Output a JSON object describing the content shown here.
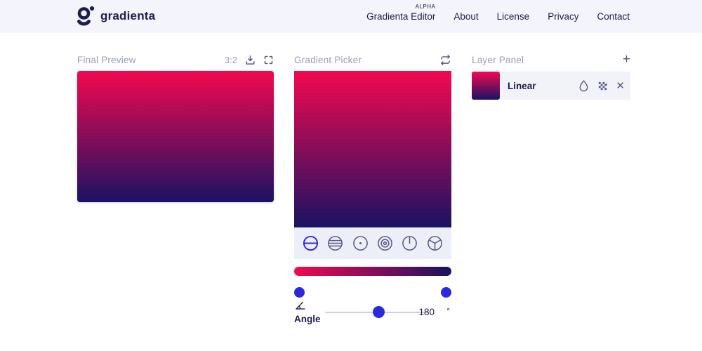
{
  "header": {
    "brand": "gradienta",
    "nav": {
      "items": [
        {
          "label": "Gradienta Editor",
          "badge": "ALPHA"
        },
        {
          "label": "About"
        },
        {
          "label": "License"
        },
        {
          "label": "Privacy"
        },
        {
          "label": "Contact"
        }
      ]
    }
  },
  "final_preview": {
    "title": "Final Preview",
    "aspect_ratio": "3:2"
  },
  "gradient_picker": {
    "title": "Gradient Picker",
    "types": [
      "linear",
      "repeating-linear",
      "radial",
      "repeating-radial",
      "conic",
      "repeating-conic"
    ],
    "active_type": "linear"
  },
  "angle": {
    "label": "Angle",
    "value": "180",
    "unit": "°"
  },
  "layer_panel": {
    "title": "Layer Panel",
    "add_label": "+",
    "layers": [
      {
        "name": "Linear",
        "close_label": "✕"
      }
    ]
  },
  "colors": {
    "gradient_start": "#f2094f",
    "gradient_end": "#1a1263",
    "accent_blue": "#2b28e0",
    "header_bg": "#f4f4fd",
    "panel_title": "#9a9db5",
    "text_dark": "#1d1d4e",
    "icon_slate": "#565a86",
    "strip_bg": "#edeff8",
    "row_bg": "#f2f2f9",
    "track_gray": "#cfcfdd"
  }
}
